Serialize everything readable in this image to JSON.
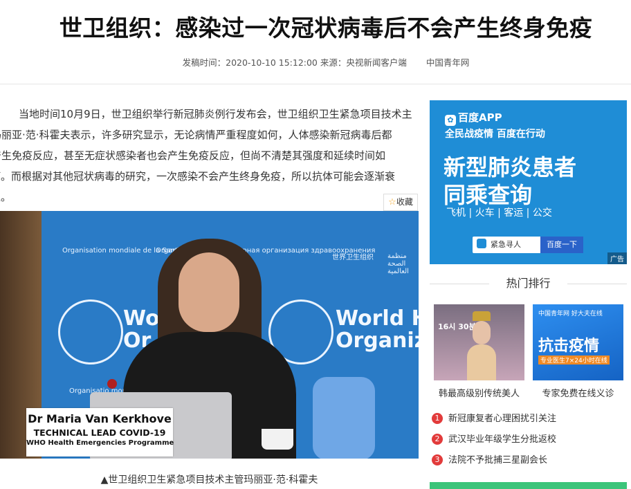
{
  "article": {
    "title": "世卫组织：感染过一次冠状病毒后不会产生终身免疫",
    "meta_publish": "发稿时间：2020-10-10 15:12:00 来源：央视新闻客户端",
    "meta_source2": "中国青年网",
    "body_lines": [
      "当地时间10月9日，世卫组织举行新冠肺炎例行发布会，世卫组织卫生紧急项目技术主",
      "管玛丽亚·范·科霍夫表示，许多研究显示，无论病情严重程度如何，人体感染新冠病毒后都",
      "会产生免疫反应，甚至无症状感染者也会产生免疫反应，但尚不清楚其强度和延续时间如",
      "何。而根据对其他冠状病毒的研究，一次感染不会产生终身免疫，所以抗体可能会逐渐衰",
      "退。"
    ],
    "favorite_label": "收藏",
    "image": {
      "who_small_left": "Organisation mondiale de la Santé",
      "who_small_mid": "Organiz Mundial",
      "who_small_ru": "рмирная организация здравоохранения",
      "who_small_cn": "世界卫生组织",
      "who_small_ar": "منظمة الصحة العالمية",
      "who_big_line1_left": "Worl",
      "who_big_line2_left": "Or",
      "who_big_line1_right": "World He",
      "who_big_line2_right": "Organizat",
      "who_small_bottom": "Organisatio mondiale",
      "nameplate_name": "Dr Maria Van Kerkhove",
      "nameplate_role": "TECHNICAL LEAD COVID-19",
      "nameplate_org": "WHO Health Emergencies Programme"
    },
    "caption": "▲世卫组织卫生紧急项目技术主管玛丽亚·范·科霍夫"
  },
  "ad": {
    "brand": "百度APP",
    "brand_icon": "paw-icon",
    "slogan": "全民战疫情 百度在行动",
    "headline1": "新型肺炎患者",
    "headline2": "同乘查询",
    "modes": "飞机 | 火车 | 客运 | 公交",
    "search_text": "紧急寻人",
    "search_button": "百度一下",
    "tag": "广告",
    "color": "#1f8dd6"
  },
  "hot": {
    "title": "热门排行",
    "cards": [
      {
        "caption": "韩最高级别传统美人",
        "thumb_text": "16시 30분"
      },
      {
        "caption": "专家免费在线义诊",
        "thumb_top": "中国青年网 好大夫在线",
        "thumb_big": "抗击疫情",
        "thumb_sub": "专业医生7×24小时在线"
      }
    ],
    "list": [
      {
        "num": "1",
        "text": "新冠康复者心理困扰引关注"
      },
      {
        "num": "2",
        "text": "武汉毕业年级学生分批返校"
      },
      {
        "num": "3",
        "text": "法院不予批捕三星副会长"
      }
    ],
    "rank_color": "#e23b3b"
  }
}
